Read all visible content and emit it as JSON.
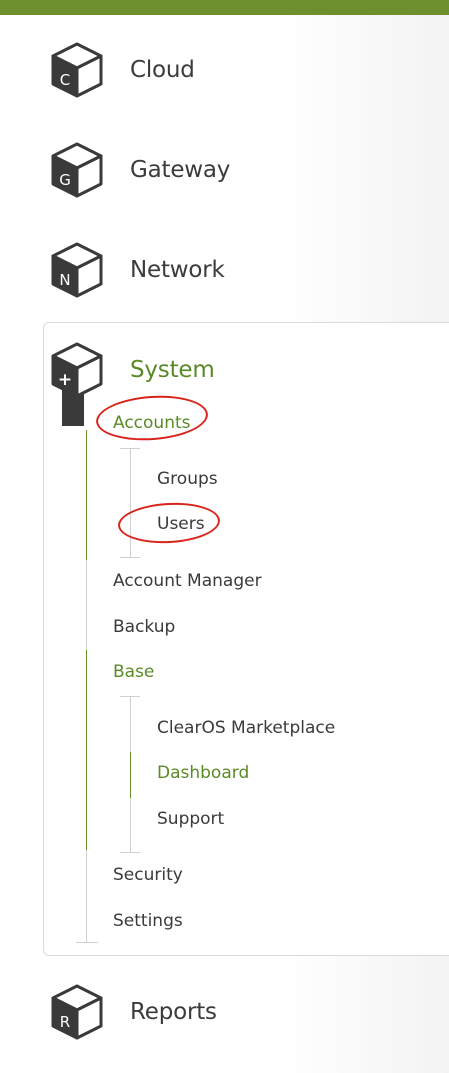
{
  "nav": {
    "categories": {
      "cloud": {
        "label": "Cloud",
        "icon_letter": "C",
        "icon": "cloud-cube-icon"
      },
      "gateway": {
        "label": "Gateway",
        "icon_letter": "G",
        "icon": "gateway-cube-icon"
      },
      "network": {
        "label": "Network",
        "icon_letter": "N",
        "icon": "network-cube-icon"
      },
      "system": {
        "label": "System",
        "icon_letter": "+",
        "icon": "system-cube-icon"
      },
      "reports": {
        "label": "Reports",
        "icon_letter": "R",
        "icon": "reports-cube-icon"
      }
    },
    "system_menu": {
      "accounts": "Accounts",
      "groups": "Groups",
      "users": "Users",
      "account_manager": "Account Manager",
      "backup": "Backup",
      "base": "Base",
      "marketplace": "ClearOS Marketplace",
      "dashboard": "Dashboard",
      "support": "Support",
      "security": "Security",
      "settings": "Settings"
    }
  },
  "colors": {
    "accent_green": "#6e8f2d",
    "active_text": "#5a8a25",
    "annotation_red": "#d9241c"
  }
}
